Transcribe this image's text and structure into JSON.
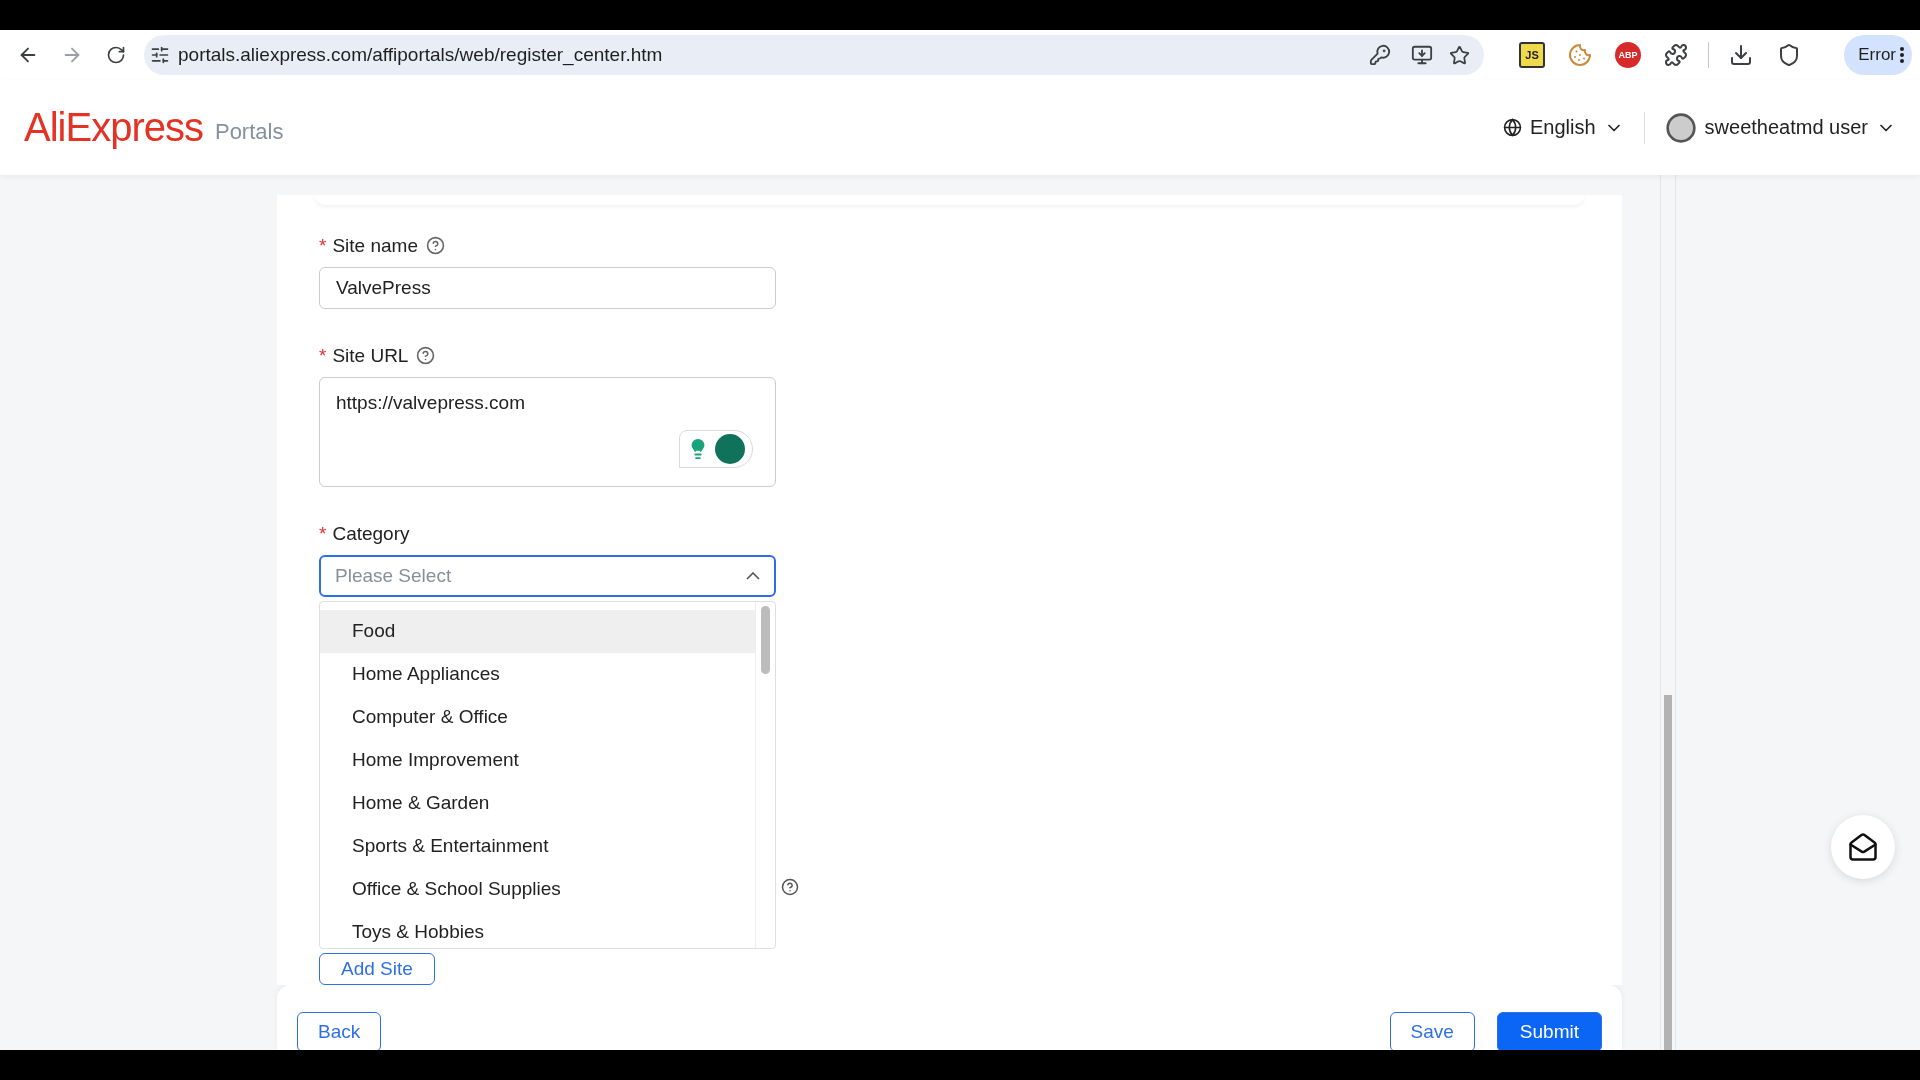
{
  "browser": {
    "url": "portals.aliexpress.com/affiportals/web/register_center.htm",
    "extensions": [
      {
        "kind": "js",
        "label": "JS"
      },
      {
        "kind": "cookie"
      },
      {
        "kind": "abp",
        "label": "ABP"
      },
      {
        "kind": "puzzle"
      }
    ],
    "profile_label": "Error"
  },
  "header": {
    "logo": "AliExpress",
    "logo_suffix": "Portals",
    "language": "English",
    "user": "sweetheatmd user"
  },
  "form": {
    "fields": [
      {
        "kind": "input",
        "label": "Site name",
        "required_mark": "*",
        "help": true,
        "value": "ValvePress"
      },
      {
        "kind": "textarea",
        "label": "Site URL",
        "required_mark": "*",
        "help": true,
        "value": "https://valvepress.com"
      },
      {
        "kind": "select",
        "label": "Category",
        "required_mark": "*",
        "help": false,
        "placeholder": "Please Select",
        "expanded": true,
        "options": [
          {
            "label": "Food",
            "highlighted": true
          },
          {
            "label": "Home Appliances",
            "highlighted": false
          },
          {
            "label": "Computer & Office",
            "highlighted": false
          },
          {
            "label": "Home Improvement",
            "highlighted": false
          },
          {
            "label": "Home & Garden",
            "highlighted": false
          },
          {
            "label": "Sports & Entertainment",
            "highlighted": false
          },
          {
            "label": "Office & School Supplies",
            "highlighted": false
          },
          {
            "label": "Toys & Hobbies",
            "highlighted": false
          }
        ]
      }
    ],
    "add_button": "Add Site"
  },
  "footer": {
    "back": "Back",
    "save": "Save",
    "submit": "Submit"
  }
}
